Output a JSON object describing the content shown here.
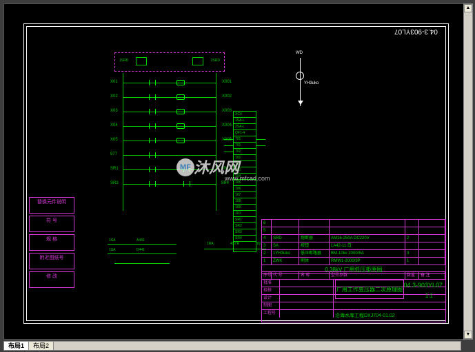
{
  "drawing_number": "04.3-903YL07",
  "drawing_number_flipped": "04.3-903YL07",
  "sld": {
    "top_label": "WD",
    "mid_label": "YH3uko"
  },
  "magenta_box": {
    "left_label": "1SRD",
    "right_label": "2SRD"
  },
  "ladder_rows": [
    {
      "l": "X01",
      "r": "X001"
    },
    {
      "l": "X02",
      "r": "X002"
    },
    {
      "l": "X03",
      "r": "X003"
    },
    {
      "l": "X04",
      "r": "X004"
    },
    {
      "l": "X05",
      "r": "X005"
    },
    {
      "l": "977",
      "r": ""
    },
    {
      "l": "SR1",
      "r": "SR2"
    },
    {
      "l": "SR3",
      "r": "SR4"
    }
  ],
  "terminals": [
    "XC4",
    "1SA-L",
    "2SA-L",
    "QF1-4",
    "701",
    "701",
    "702",
    "101",
    "102",
    "103",
    "104",
    "105",
    "106",
    "107",
    "108",
    "109",
    "110",
    "SR1",
    "SR2",
    "SR3",
    "SR4"
  ],
  "left_table": [
    "替换元件说明",
    "符  号",
    "规  格",
    "附近图纸号",
    "修 改"
  ],
  "relay": {
    "row1_l": "1SA",
    "row1_m": "A441",
    "row2_l": "1SA",
    "row2_m": "D441",
    "sw_l": "1RA",
    "sw_m": "4SYR",
    "sw_r": "702"
  },
  "title_block": {
    "parts_rows": [
      {
        "n": "6",
        "sym": "",
        "name": "",
        "model": "",
        "qty": ""
      },
      {
        "n": "5",
        "sym": "",
        "name": "",
        "model": "",
        "qty": ""
      },
      {
        "n": "4",
        "sym": "SRD",
        "name": "熔断器",
        "model": "AM16-250A DC220V",
        "qty": "2"
      },
      {
        "n": "3",
        "sym": "SA",
        "name": "按钮",
        "model": "LA42-11 白",
        "qty": ""
      },
      {
        "n": "2",
        "sym": "1YH3uko",
        "name": "低压断路器",
        "model": "BM-10kv 2000/5A",
        "qty": "3"
      },
      {
        "n": "1",
        "sym": "ZWK",
        "name": "刷体",
        "model": "RMW1-2000/3P",
        "qty": "1"
      }
    ],
    "parts_header": [
      "序号",
      "代 号",
      "名 称",
      "型号参数",
      "数量",
      "备 注"
    ],
    "banner": "0.38kV 厂用低压柜原图",
    "title": "厂用工作变压器二次原理图",
    "project": "沿海水库工程DXJ704-01.02",
    "drawing_no": "04.3-903YL07",
    "scale": "1:1",
    "lower_left_rows": [
      "批准",
      "校核",
      "设计",
      "制图",
      "工程号"
    ]
  },
  "tabs": {
    "tab1": "布局1",
    "tab2": "布局2"
  },
  "watermark": {
    "logo": "MF",
    "text": "沐风网",
    "url": "www.mfcad.com"
  }
}
